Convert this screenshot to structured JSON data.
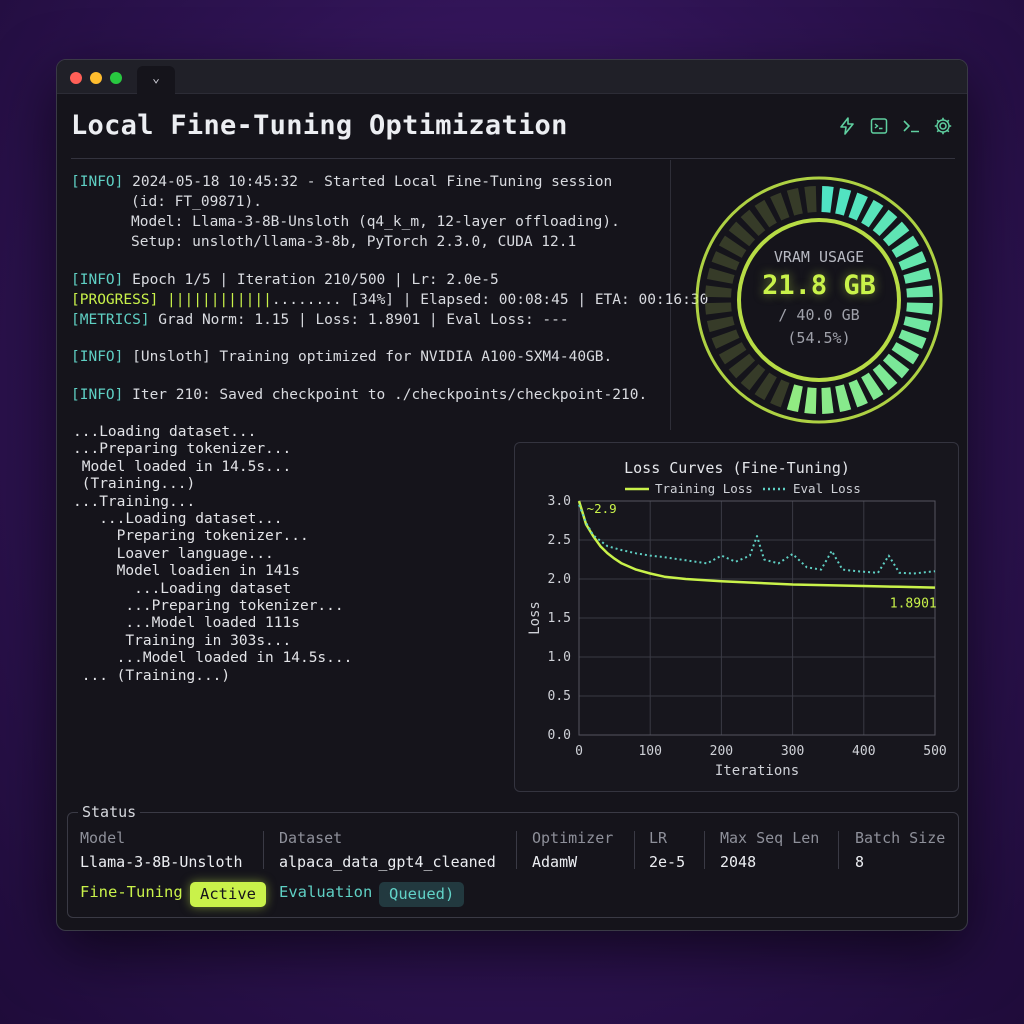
{
  "window": {
    "tab_icon": "chevron-down-icon",
    "tab_glyph": "⌄"
  },
  "app": {
    "title": "Local Fine-Tuning Optimization"
  },
  "toolbar": {
    "icons": [
      "bolt-icon",
      "terminal-window-icon",
      "prompt-icon",
      "gear-icon"
    ]
  },
  "log": {
    "l1_tag": "[INFO]",
    "l1_text": " 2024-05-18 10:45:32 - Started Local Fine-Tuning session",
    "l2_text": "(id: FT_09871).",
    "l3_text": "Model: Llama-3-8B-Unsloth (q4_k_m, 12-layer offloading).",
    "l4_text": "Setup: unsloth/llama-3-8b, PyTorch 2.3.0, CUDA 12.1",
    "l5_tag": "[INFO]",
    "l5_text": " Epoch 1/5 | Iteration 210/500 | Lr: 2.0e-5",
    "l6_tag": "[PROGRESS]",
    "l6_bar": " ||||||||||||",
    "l6_text": "........ [34%] | Elapsed: 00:08:45 | ETA: 00:16:30",
    "l7_tag": "[METRICS]",
    "l7_text": " Grad Norm: 1.15 | Loss: 1.8901 | Eval Loss: ---",
    "l8_tag": "[INFO]",
    "l8_text": " [Unsloth] Training optimized for NVIDIA A100-SXM4-40GB.",
    "l9_tag": "[INFO]",
    "l9_text": " Iter 210: Saved checkpoint to ./checkpoints/checkpoint-210."
  },
  "stream": [
    "...Loading dataset...",
    "...Preparing tokenizer...",
    " Model loaded in 14.5s...",
    " (Training...)",
    "...Training...",
    "   ...Loading dataset...",
    "     Preparing tokenizer...",
    "     Loaver language...",
    "     Model loadien in 141s",
    "       ...Loading dataset",
    "      ...Preparing tokenizer...",
    "      ...Model loaded 111s",
    "      Training in 303s...",
    "     ...Model loaded in 14.5s...",
    " ... (Training...)"
  ],
  "gauge": {
    "title": "VRAM USAGE",
    "value": "21.8 GB",
    "total": "/ 40.0 GB",
    "percent": "(54.5%)",
    "fraction": 0.545,
    "colors": {
      "start": "#c9f24a",
      "end": "#4fe3c4",
      "track": "#3a3f2a"
    }
  },
  "chart_data": {
    "type": "line",
    "title": "Loss Curves (Fine-Tuning)",
    "xlabel": "Iterations",
    "ylabel": "Loss",
    "xlim": [
      0,
      500
    ],
    "ylim": [
      0,
      3
    ],
    "xticks": [
      0,
      100,
      200,
      300,
      400,
      500
    ],
    "yticks": [
      0.0,
      0.5,
      1.0,
      1.5,
      2.0,
      2.5,
      3.0
    ],
    "grid": true,
    "legend": "top",
    "annotations": [
      {
        "text": "~2.9",
        "x": 5,
        "y": 2.9
      },
      {
        "text": "1.8901",
        "x": 480,
        "y": 1.8901
      }
    ],
    "series": [
      {
        "name": "Training Loss",
        "style": "solid",
        "color": "#c9f24a",
        "x": [
          0,
          5,
          10,
          20,
          30,
          40,
          50,
          60,
          80,
          100,
          120,
          150,
          200,
          250,
          300,
          350,
          400,
          450,
          500
        ],
        "y": [
          3.0,
          2.85,
          2.7,
          2.55,
          2.42,
          2.33,
          2.26,
          2.2,
          2.12,
          2.07,
          2.03,
          2.0,
          1.97,
          1.95,
          1.93,
          1.92,
          1.91,
          1.9,
          1.89
        ]
      },
      {
        "name": "Eval Loss",
        "style": "dotted",
        "color": "#5fd0c4",
        "x": [
          0,
          10,
          20,
          40,
          60,
          80,
          100,
          120,
          150,
          180,
          200,
          220,
          240,
          250,
          260,
          280,
          300,
          320,
          340,
          355,
          370,
          390,
          420,
          435,
          450,
          470,
          500
        ],
        "y": [
          2.95,
          2.72,
          2.56,
          2.42,
          2.37,
          2.33,
          2.3,
          2.28,
          2.24,
          2.2,
          2.3,
          2.22,
          2.3,
          2.55,
          2.25,
          2.2,
          2.32,
          2.15,
          2.12,
          2.36,
          2.12,
          2.1,
          2.08,
          2.3,
          2.08,
          2.07,
          2.1
        ]
      }
    ]
  },
  "status": {
    "title": "Status",
    "columns": [
      {
        "header": "Model",
        "value": "Llama-3-8B-Unsloth"
      },
      {
        "header": "Dataset",
        "value": "alpaca_data_gpt4_cleaned"
      },
      {
        "header": "Optimizer",
        "value": "AdamW"
      },
      {
        "header": "LR",
        "value": "2e-5"
      },
      {
        "header": "Max Seq Len",
        "value": "2048"
      },
      {
        "header": "Batch Size",
        "value": "8"
      }
    ],
    "phase1_label": "Fine-Tuning",
    "phase1_state": "Active",
    "phase2_label": "Evaluation",
    "phase2_state": "Queued)"
  }
}
